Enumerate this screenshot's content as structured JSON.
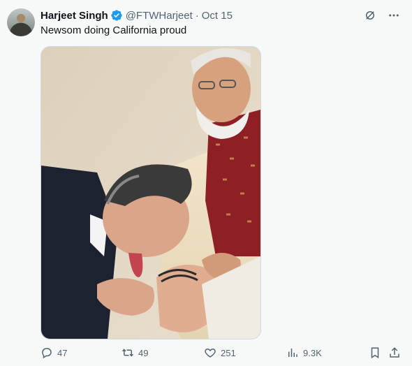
{
  "tweet": {
    "author_name": "Harjeet Singh",
    "handle": "@FTWHarjeet",
    "separator": "·",
    "date": "Oct 15",
    "text": "Newsom doing California proud"
  },
  "stats": {
    "replies": "47",
    "reposts": "49",
    "likes": "251",
    "views": "9.3K"
  },
  "icons": {
    "verified": "verified-badge-icon",
    "grok": "grok-icon",
    "more": "more-icon",
    "reply": "reply-icon",
    "repost": "repost-icon",
    "like": "heart-icon",
    "views": "views-icon",
    "bookmark": "bookmark-icon",
    "share": "share-icon"
  },
  "colors": {
    "verified": "#1d9bf0",
    "secondary_text": "#536471",
    "primary_text": "#0f1419"
  }
}
